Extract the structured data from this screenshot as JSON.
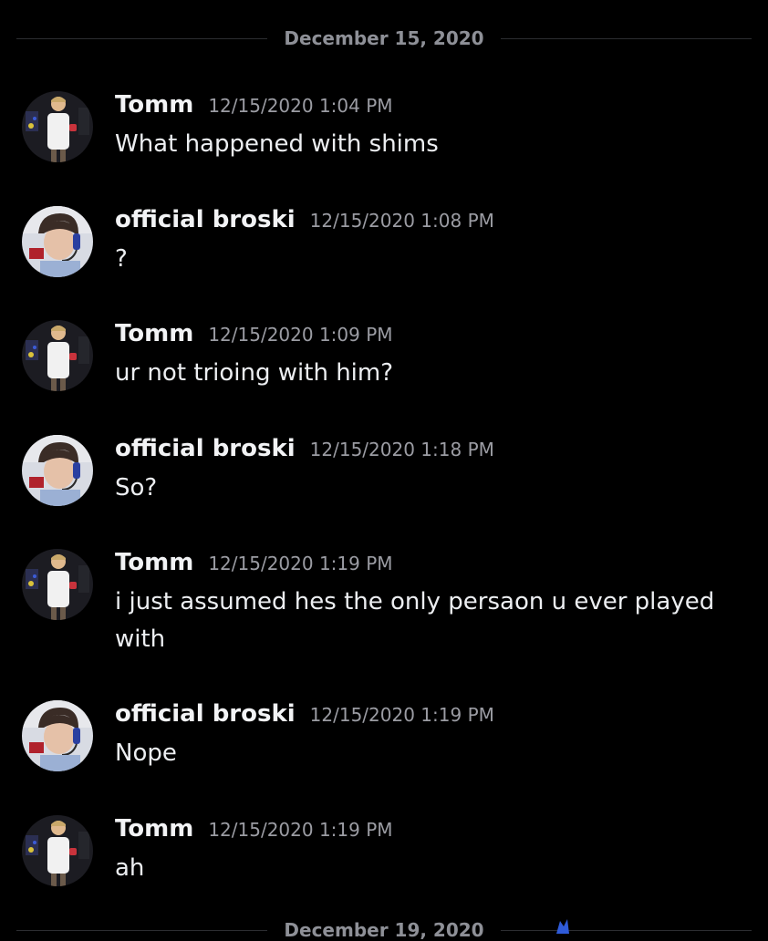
{
  "date_dividers": [
    {
      "label": "December 15, 2020"
    },
    {
      "label": "December 19, 2020"
    }
  ],
  "messages": [
    {
      "avatar": "tomm-avatar",
      "username": "Tomm",
      "timestamp": "12/15/2020 1:04 PM",
      "text": "What happened with shims"
    },
    {
      "avatar": "broski-avatar",
      "username": "official broski",
      "timestamp": "12/15/2020 1:08 PM",
      "text": "?"
    },
    {
      "avatar": "tomm-avatar",
      "username": "Tomm",
      "timestamp": "12/15/2020 1:09 PM",
      "text": "ur not trioing with him?"
    },
    {
      "avatar": "broski-avatar",
      "username": "official broski",
      "timestamp": "12/15/2020 1:18 PM",
      "text": "So?"
    },
    {
      "avatar": "tomm-avatar",
      "username": "Tomm",
      "timestamp": "12/15/2020 1:19 PM",
      "text": "i just assumed hes the only persaon u ever played with"
    },
    {
      "avatar": "broski-avatar",
      "username": "official broski",
      "timestamp": "12/15/2020 1:19 PM",
      "text": "Nope"
    },
    {
      "avatar": "tomm-avatar",
      "username": "Tomm",
      "timestamp": "12/15/2020 1:19 PM",
      "text": "ah"
    }
  ],
  "colors": {
    "background": "#000000",
    "username": "#f2f3f5",
    "timestamp": "#9b9ca3",
    "divider_text": "#8e9097",
    "divider_line": "#2c2d31"
  }
}
